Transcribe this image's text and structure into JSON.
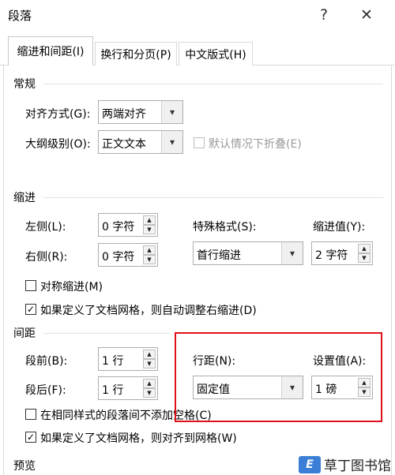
{
  "window": {
    "title": "段落",
    "help_glyph": "?",
    "close_glyph": "✕"
  },
  "tabs": [
    {
      "label": "缩进和间距(I)",
      "active": true
    },
    {
      "label": "换行和分页(P)",
      "active": false
    },
    {
      "label": "中文版式(H)",
      "active": false
    }
  ],
  "general": {
    "title": "常规",
    "alignment_label": "对齐方式(G):",
    "alignment_value": "两端对齐",
    "outline_label": "大纲级别(O):",
    "outline_value": "正文文本",
    "collapse_label": "默认情况下折叠(E)"
  },
  "indent": {
    "title": "缩进",
    "left_label": "左侧(L):",
    "left_value": "0 字符",
    "right_label": "右侧(R):",
    "right_value": "0 字符",
    "special_label": "特殊格式(S):",
    "special_value": "首行缩进",
    "by_label": "缩进值(Y):",
    "by_value": "2 字符",
    "mirror_label": "对称缩进(M)",
    "auto_adjust_label": "如果定义了文档网格，则自动调整右缩进(D)"
  },
  "spacing": {
    "title": "间距",
    "before_label": "段前(B):",
    "before_value": "1 行",
    "after_label": "段后(F):",
    "after_value": "1 行",
    "line_label": "行距(N):",
    "line_value": "固定值",
    "at_label": "设置值(A):",
    "at_value": "1 磅",
    "no_space_label": "在相同样式的段落间不添加空格(C)",
    "snap_grid_label": "如果定义了文档网格，则对齐到网格(W)"
  },
  "preview": {
    "title": "预览"
  },
  "glyphs": {
    "check": "✓",
    "dropdown": "▾",
    "up": "▲",
    "down": "▼"
  },
  "watermark": {
    "logo": "E",
    "text": "草丁图书馆"
  },
  "colors": {
    "annotation_red": "#e0101a",
    "watermark_blue": "#3a7fd5"
  }
}
